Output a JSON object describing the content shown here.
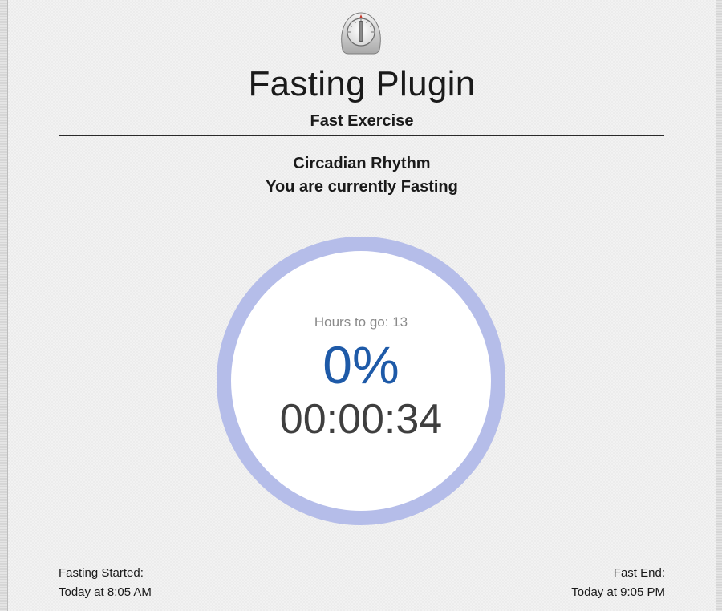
{
  "header": {
    "icon": "kitchen-timer-icon",
    "title": "Fasting Plugin",
    "subtitle": "Fast Exercise"
  },
  "plan": {
    "name": "Circadian Rhythm",
    "status": "You are currently Fasting"
  },
  "progress": {
    "hours_to_go": "Hours to go: 13",
    "percent_label": "0%",
    "percent": 0,
    "elapsed": "00:00:34"
  },
  "footer": {
    "started_label": "Fasting Started:",
    "started_value": "Today at 8:05 AM",
    "end_label": "Fast End:",
    "end_value": "Today at 9:05 PM"
  },
  "colors": {
    "ring": "#b5bde9",
    "ring_progress": "#1e5aa8",
    "percent_text": "#1e5aa8",
    "panel_background": "#f2f2f2"
  }
}
